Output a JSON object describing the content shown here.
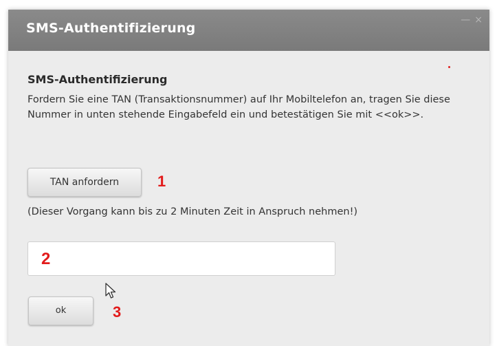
{
  "dialog": {
    "title": "SMS-Authentifizierung",
    "window_controls": [
      "—",
      "×"
    ],
    "heading": "SMS-Authentifizierung",
    "description": "Fordern Sie eine TAN (Transaktionsnummer) auf Ihr Mobiltelefon an, tragen Sie diese Nummer in unten stehende Eingabefeld ein und betestätigen Sie mit <<ok>>.",
    "request_button_label": "TAN anfordern",
    "hint": "(Dieser Vorgang kann bis zu 2 Minuten Zeit in Anspruch nehmen!)",
    "tan_input_value": "",
    "ok_button_label": "ok"
  },
  "annotations": {
    "step1": "1",
    "step2": "2",
    "step3": "3",
    "color": "#e21b1b"
  },
  "icons": [
    "minimize-icon",
    "close-icon",
    "mouse-pointer-icon"
  ]
}
